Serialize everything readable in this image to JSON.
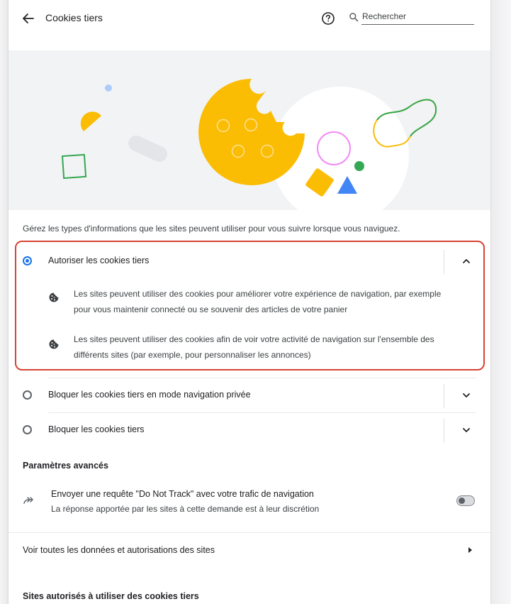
{
  "header": {
    "title": "Cookies tiers",
    "search_placeholder": "Rechercher"
  },
  "description": "Gérez les types d'informations que les sites peuvent utiliser pour vous suivre lorsque vous naviguez.",
  "options": [
    {
      "label": "Autoriser les cookies tiers",
      "selected": true,
      "expanded": true,
      "details": [
        {
          "line1": "Les sites peuvent utiliser des cookies pour améliorer votre expérience de navigation, par exemple",
          "line2": "pour vous maintenir connecté ou se souvenir des articles de votre panier"
        },
        {
          "line1": "Les sites peuvent utiliser des cookies afin de voir votre activité de navigation sur l'ensemble des",
          "line2": "différents sites (par exemple, pour personnaliser les annonces)"
        }
      ]
    },
    {
      "label": "Bloquer les cookies tiers en mode navigation privée",
      "selected": false,
      "expanded": false
    },
    {
      "label": "Bloquer les cookies tiers",
      "selected": false,
      "expanded": false
    }
  ],
  "advanced": {
    "title": "Paramètres avancés",
    "dnt_primary": "Envoyer une requête \"Do Not Track\" avec votre trafic de navigation",
    "dnt_secondary": "La réponse apportée par les sites à cette demande est à leur discrétion",
    "dnt_enabled": false
  },
  "site_data_link": "Voir toutes les données et autorisations des sites",
  "allowed_sites_title": "Sites autorisés à utiliser des cookies tiers",
  "colors": {
    "accent": "#1a73e8",
    "highlight": "#d74335",
    "cookie": "#fbbc04",
    "green": "#34a853",
    "pink": "#f28bf6"
  }
}
